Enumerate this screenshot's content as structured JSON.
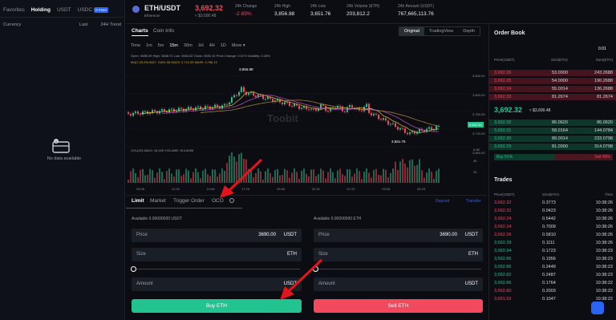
{
  "sidebar": {
    "tabs": [
      "Favorites",
      "Holding",
      "USDT",
      "USDC"
    ],
    "new_badge": "0 Fees",
    "columns": [
      "Currency",
      "Last",
      "24H Trend"
    ],
    "empty_text": "No data available"
  },
  "header": {
    "pair": "ETH/USDT",
    "coin_name": "Ethereum",
    "last_price": "3,692.32",
    "last_price_usd": "≈ $3,690.48",
    "stats": [
      {
        "label": "24h Change",
        "value": "-2.69%"
      },
      {
        "label": "24h High",
        "value": "3,856.88"
      },
      {
        "label": "24h Low",
        "value": "3,651.76"
      },
      {
        "label": "24h Volume (ETH)",
        "value": "203,812.2"
      },
      {
        "label": "24h Amount (USDT)",
        "value": "767,665,113.76"
      }
    ]
  },
  "chart_tabs": {
    "charts": "Charts",
    "coin_info": "Coin Info"
  },
  "view_modes": [
    "Original",
    "TradingView",
    "Depth"
  ],
  "timeframes": [
    "Time",
    "1m",
    "5m",
    "15m",
    "30m",
    "1H",
    "4H",
    "1D",
    "More ▾"
  ],
  "chart_info": {
    "ohlc": "Open: 3685.39  High: 3688.72  Low: 3684.82  Close: 3692.32  Price Change: 0.01%  Volatility: 0.28%",
    "ma": "MA(7,25,99)   MA7: 3,694.08   MA25: 3,710.35   MA99: 3,766.12",
    "vol": "VOL(20)   MA20: 16,049   VOLUME: 813.6058",
    "high_label": "3,856.88",
    "low_label": "3,651.76",
    "last_tag": "3,692.32",
    "watermark": "Toobit"
  },
  "price_axis": [
    "3,840.00",
    "3,800.00",
    "3,760.00",
    "3,720.00",
    "3,680.00"
  ],
  "vol_axis": [
    "6.8K",
    "4K",
    "2K"
  ],
  "time_axis": [
    "09:45",
    "12:15",
    "14:45",
    "17:15",
    "19:45",
    "22:15",
    "07-22",
    "03:45",
    "06:15"
  ],
  "order_tabs": {
    "limit": "Limit",
    "market": "Market",
    "trigger": "Trigger Order",
    "oco": "OCO"
  },
  "order_links": {
    "deposit": "Deposit",
    "transfer": "Transfer"
  },
  "buy": {
    "available": "Available 0.00000000 USDT",
    "price_label": "Price",
    "price_value": "3690.00",
    "price_unit": "USDT",
    "size_label": "Size",
    "size_unit": "ETH",
    "amount_label": "Amount",
    "amount_unit": "USDT",
    "button": "Buy ETH"
  },
  "sell": {
    "available": "Available 0.00000000 ETH",
    "price_label": "Price",
    "price_value": "3690.00",
    "price_unit": "USDT",
    "size_label": "Size",
    "size_unit": "ETH",
    "amount_label": "Amount",
    "amount_unit": "USDT",
    "button": "Sell ETH"
  },
  "order_book": {
    "title": "Order Book",
    "precision": "0.01",
    "columns": [
      "Price(USDT)",
      "Size(ETH)",
      "Sum(ETH)"
    ],
    "asks": [
      [
        "3,692.36",
        "53.0000",
        "243.2688"
      ],
      [
        "3,692.35",
        "54.0000",
        "190.2688"
      ],
      [
        "3,692.34",
        "55.0014",
        "136.2688"
      ],
      [
        "3,692.33",
        "81.2674",
        "81.2674"
      ]
    ],
    "mid_price": "3,692.32",
    "mid_usd": "≈ $3,690.48",
    "bids": [
      [
        "3,692.32",
        "86.0620",
        "86.0620"
      ],
      [
        "3,692.31",
        "58.0164",
        "144.0784"
      ],
      [
        "3,692.30",
        "89.0014",
        "233.0798"
      ],
      [
        "3,692.29",
        "81.0000",
        "314.0798"
      ]
    ],
    "buy_ratio": "Buy 51%",
    "sell_ratio": "Sell 49%",
    "buy_fraction": 0.51
  },
  "trades": {
    "title": "Trades",
    "columns": [
      "Price(USDT)",
      "Size(ETH)",
      "Time"
    ],
    "rows": [
      [
        "3,692.32",
        "0.3773",
        "10:38:26",
        "red"
      ],
      [
        "3,692.32",
        "0.0423",
        "10:38:26",
        "red"
      ],
      [
        "3,692.24",
        "0.5442",
        "10:38:26",
        "red"
      ],
      [
        "3,692.24",
        "0.7009",
        "10:38:26",
        "red"
      ],
      [
        "3,692.26",
        "0.5810",
        "10:38:26",
        "red"
      ],
      [
        "3,692.39",
        "0.1111",
        "10:38:26",
        "green"
      ],
      [
        "3,692.94",
        "0.1723",
        "10:38:23",
        "green"
      ],
      [
        "3,692.86",
        "0.1956",
        "10:38:23",
        "green"
      ],
      [
        "3,692.86",
        "0.2449",
        "10:38:23",
        "green"
      ],
      [
        "3,692.82",
        "0.2487",
        "10:38:23",
        "green"
      ],
      [
        "3,692.86",
        "0.1764",
        "10:38:22",
        "green"
      ],
      [
        "3,692.80",
        "0.2003",
        "10:38:22",
        "red"
      ],
      [
        "3,691.93",
        "0.1047",
        "10:38:22",
        "red"
      ]
    ]
  },
  "colors": {
    "up": "#22c38e",
    "down": "#f2495c",
    "accent": "#2b63f6",
    "annotation": "#e3141c"
  }
}
